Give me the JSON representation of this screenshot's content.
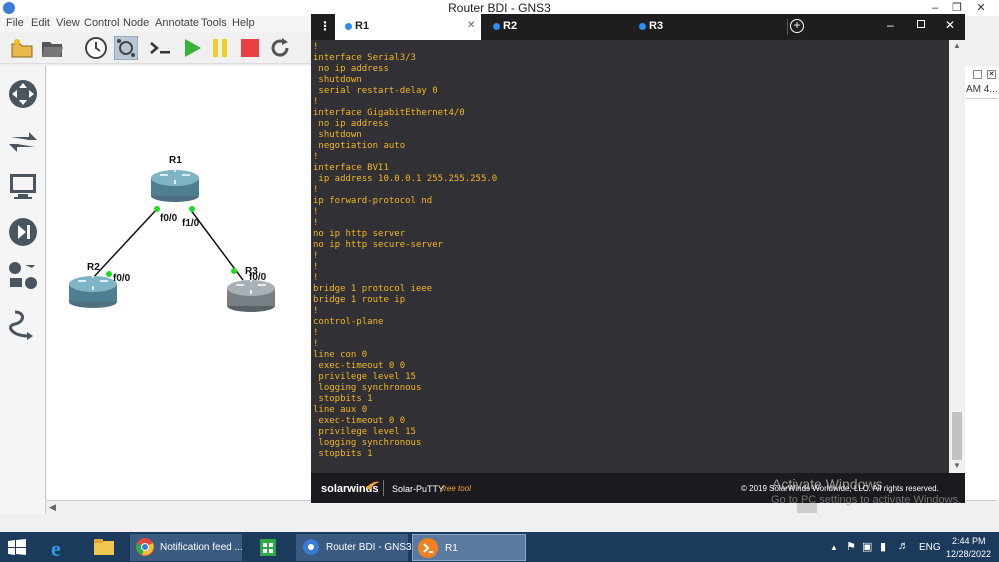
{
  "gns3": {
    "title": "Router BDI - GNS3",
    "menu": [
      "File",
      "Edit",
      "View",
      "Control",
      "Node",
      "Annotate",
      "Tools",
      "Help"
    ],
    "right_panel_text": "AM 4..."
  },
  "topology": {
    "nodes": [
      {
        "name": "R1"
      },
      {
        "name": "R2"
      },
      {
        "name": "R3"
      }
    ],
    "labels": {
      "r1_f00": "f0/0",
      "r1_f10": "f1/0",
      "r2_f00": "f0/0",
      "r3_f00": "f0/0"
    }
  },
  "putty": {
    "tabs": [
      {
        "label": "R1",
        "active": true
      },
      {
        "label": "R2",
        "active": false
      },
      {
        "label": "R3",
        "active": false
      }
    ],
    "terminal_lines": [
      "!",
      "interface Serial3/3",
      " no ip address",
      " shutdown",
      " serial restart-delay 0",
      "!",
      "interface GigabitEthernet4/0",
      " no ip address",
      " shutdown",
      " negotiation auto",
      "!",
      "interface BVI1",
      " ip address 10.0.0.1 255.255.255.0",
      "!",
      "ip forward-protocol nd",
      "!",
      "!",
      "no ip http server",
      "no ip http secure-server",
      "!",
      "!",
      "!",
      "bridge 1 protocol ieee",
      "bridge 1 route ip",
      "!",
      "control-plane",
      "!",
      "!",
      "line con 0",
      " exec-timeout 0 0",
      " privilege level 15",
      " logging synchronous",
      " stopbits 1",
      "line aux 0",
      " exec-timeout 0 0",
      " privilege level 15",
      " logging synchronous",
      " stopbits 1"
    ],
    "footer_brand": "solarwinds",
    "footer_product": "Solar-PuTTY",
    "footer_free": "free tool",
    "footer_copyright": "© 2019 SolarWinds Worldwide, LLC. All rights reserved."
  },
  "watermark": {
    "line1": "Activate Windows",
    "line2": "Go to PC settings to activate Windows."
  },
  "taskbar": {
    "tasks": [
      "Notification feed ...",
      "Router BDI - GNS3",
      "R1"
    ],
    "lang": "ENG",
    "time": "2:44 PM",
    "date": "12/28/2022"
  },
  "colors": {
    "terminal_text": "#f5b71e",
    "accent_blue": "#2b8ef0",
    "link_green": "#1fdc1f"
  }
}
